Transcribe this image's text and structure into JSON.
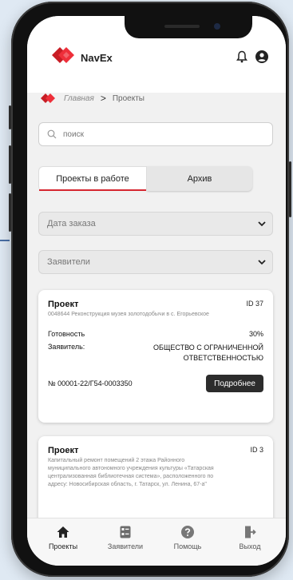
{
  "header": {
    "brand": "NavEx"
  },
  "breadcrumb": {
    "home": "Главная",
    "separator": ">",
    "current": "Проекты"
  },
  "search": {
    "placeholder": "поиск"
  },
  "tabs": [
    {
      "label": "Проекты в работе",
      "active": true
    },
    {
      "label": "Архив",
      "active": false
    }
  ],
  "filters": [
    {
      "label": "Дата заказа"
    },
    {
      "label": "Заявители"
    }
  ],
  "projects": [
    {
      "title": "Проект",
      "id": "ID 37",
      "description": "0048644 Реконструкция музея золотодобычи в с. Егорьевское",
      "readiness_label": "Готовность",
      "readiness_value": "30%",
      "applicant_label": "Заявитель:",
      "applicant_value": "ОБЩЕСТВО С ОГРАНИЧЕННОЙ ОТВЕТСТВЕННОСТЬЮ",
      "number": "№ 00001-22/Г54-0003350",
      "button": "Подробнее"
    },
    {
      "title": "Проект",
      "id": "ID 3",
      "description": "Капитальный ремонт помещений 2 этажа Районного муниципального автономного учреждения культуры «Татарская централизованная библиотечная система», расположенного по адресу: Новосибирская область, г. Татарск, ул. Ленина, 67-а\""
    }
  ],
  "tabbar": [
    {
      "label": "Проекты",
      "icon": "home-icon",
      "active": true
    },
    {
      "label": "Заявители",
      "icon": "applicants-icon",
      "active": false
    },
    {
      "label": "Помощь",
      "icon": "help-icon",
      "active": false
    },
    {
      "label": "Выход",
      "icon": "logout-icon",
      "active": false
    }
  ],
  "colors": {
    "accent": "#d62630",
    "dark_button": "#2c2c2c"
  }
}
